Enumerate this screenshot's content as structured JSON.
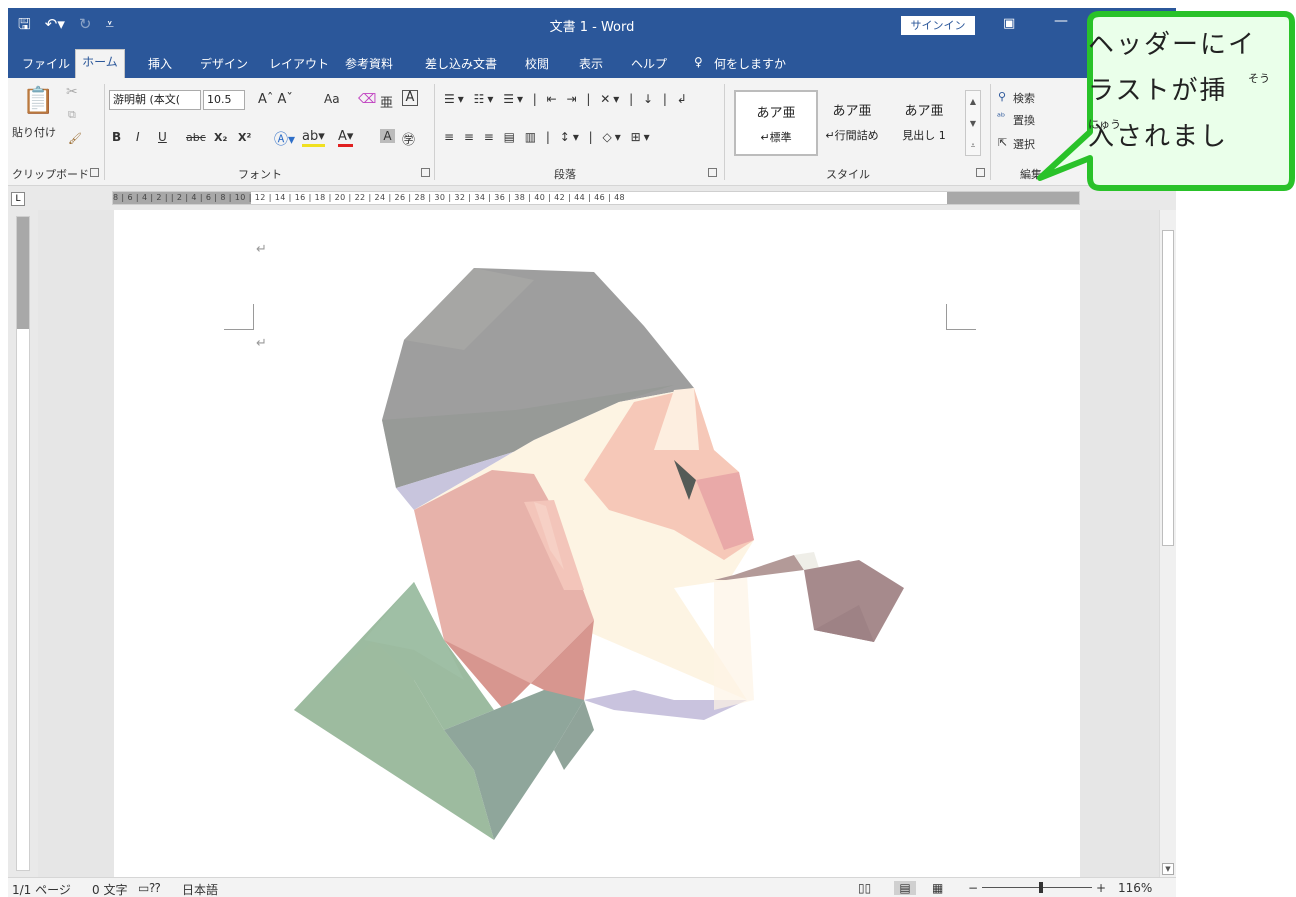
{
  "title_bar": {
    "title": "文書 1 - Word",
    "signin_label": "サインイン",
    "save_icon": "save-icon",
    "undo_icon": "undo-icon",
    "redo_icon": "redo-icon",
    "qat_more": "⩡"
  },
  "tabs": [
    "ファイル",
    "ホーム",
    "挿入",
    "デザイン",
    "レイアウト",
    "参考資料",
    "差し込み文書",
    "校閲",
    "表示",
    "ヘルプ"
  ],
  "tell_me": "何をしますか",
  "ribbon": {
    "clipboard": {
      "label": "クリップボード",
      "paste_label": "貼り付け"
    },
    "font": {
      "label": "フォント",
      "font_name": "游明朝 (本文(",
      "font_size": "10.5",
      "bold": "B",
      "italic": "I",
      "underline": "U",
      "strike": "abc",
      "sub": "X₂",
      "sup": "X²",
      "case": "Aa"
    },
    "paragraph": {
      "label": "段落"
    },
    "styles": {
      "label": "スタイル",
      "items": [
        {
          "preview": "あア亜",
          "name": "↵標準"
        },
        {
          "preview": "あア亜",
          "name": "↵行間詰め"
        },
        {
          "preview": "あア亜",
          "name": "見出し 1"
        }
      ]
    },
    "editing": {
      "label": "編集",
      "find": "検索",
      "replace": "置換",
      "select": "選択"
    }
  },
  "ruler": {
    "numbers": "8 | 6 | 4 | 2 |   | 2 | 4 | 6 | 8 | 10 | 12 | 14 | 16 | 18 | 20 | 22 | 24 | 26 | 28 | 30 | 32 | 34 | 36 | 38 | 40 | 42 | 44 | 46 | 48"
  },
  "document": {
    "para_mark": "↵",
    "illustration": "man-with-pipe-illustration"
  },
  "status": {
    "page": "1/1 ページ",
    "words": "0 文字",
    "language": "日本語",
    "zoom": "116%",
    "zoom_minus": "−",
    "zoom_plus": "+"
  },
  "callout": {
    "line1": "ヘッダーにイ",
    "line2": "ラストが挿",
    "line3": "入されまし",
    "ruby_sou": "そう",
    "ruby_nyuu": "にゅう"
  },
  "colors": {
    "title_bar": "#2b579a",
    "callout_fill": "#eaffea",
    "callout_border": "#29c229"
  }
}
